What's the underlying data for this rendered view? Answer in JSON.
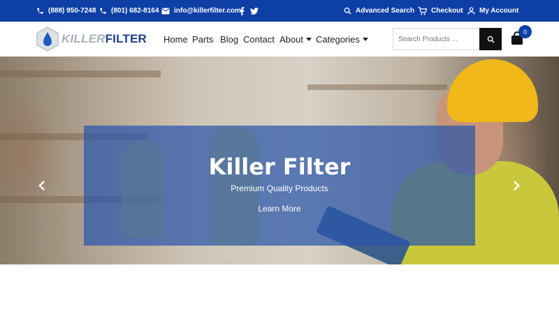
{
  "topbar": {
    "phone1": "(888) 950-7248",
    "phone2": "(801) 682-8164",
    "email": "info@killerfilter.com",
    "advanced_search": "Advanced Search",
    "checkout": "Checkout",
    "my_account": "My Account"
  },
  "brand": {
    "part1": "KILLER",
    "part2": "FILTER"
  },
  "nav": {
    "home": "Home",
    "parts": "Parts",
    "blog": "Blog",
    "contact": "Contact",
    "about": "About",
    "categories": "Categories"
  },
  "search": {
    "placeholder": "Search Products ..."
  },
  "cart": {
    "count": "0"
  },
  "hero": {
    "title": "Killer Filter",
    "subtitle": "Premium Quality Products",
    "cta": "Learn More"
  },
  "colors": {
    "brand_blue": "#0d3fa6",
    "overlay": "#2a56aa",
    "search_button": "#111111"
  }
}
